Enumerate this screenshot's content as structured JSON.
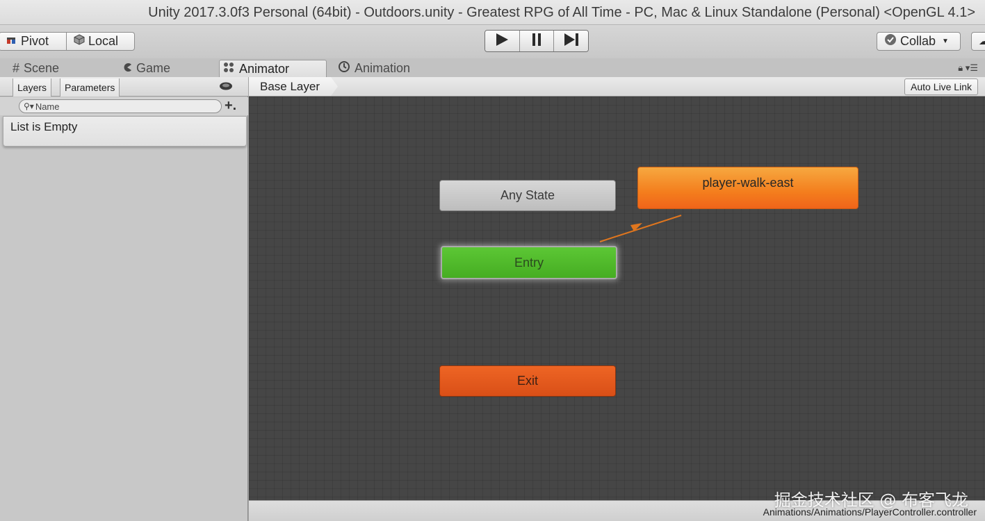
{
  "window": {
    "title": "Unity 2017.3.0f3 Personal (64bit) - Outdoors.unity - Greatest RPG of All Time - PC, Mac & Linux Standalone (Personal) <OpenGL 4.1>"
  },
  "toolbar": {
    "pivot_label": "Pivot",
    "local_label": "Local",
    "collab_label": "Collab",
    "icons": [
      "pivot-icon",
      "local-icon",
      "play-icon",
      "pause-icon",
      "step-icon",
      "collab-check-icon",
      "dropdown-icon"
    ]
  },
  "tabs": [
    {
      "label": "Scene",
      "icon": "grid-icon",
      "active": false
    },
    {
      "label": "Game",
      "icon": "pacman-icon",
      "active": false
    },
    {
      "label": "Animator",
      "icon": "animator-icon",
      "active": true
    },
    {
      "label": "Animation",
      "icon": "clock-icon",
      "active": false
    }
  ],
  "left_panel": {
    "tabs": [
      "Layers",
      "Parameters"
    ],
    "search_placeholder": "Name",
    "empty_text": "List is Empty"
  },
  "graph": {
    "breadcrumb": "Base Layer",
    "auto_live_link": "Auto Live Link",
    "nodes": {
      "any_state": "Any State",
      "entry": "Entry",
      "exit": "Exit",
      "state": "player-walk-east"
    },
    "colors": {
      "entry": "#4fbd28",
      "default_state": "#f47e1d",
      "exit": "#e25a1c",
      "any_state": "#c9c9c9",
      "transition": "#e0761e"
    }
  },
  "status": {
    "path": "Animations/Animations/PlayerController.controller"
  },
  "watermark": "掘金技术社区 @ 布客飞龙"
}
